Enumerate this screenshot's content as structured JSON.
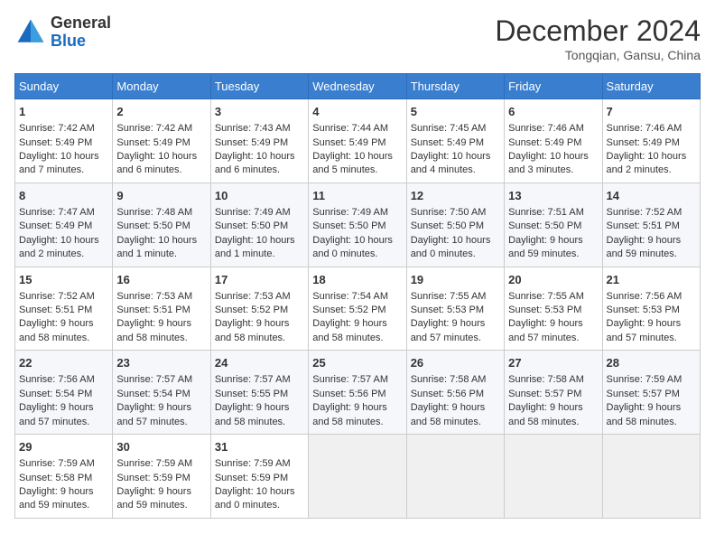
{
  "logo": {
    "general": "General",
    "blue": "Blue"
  },
  "title": "December 2024",
  "subtitle": "Tongqian, Gansu, China",
  "days": [
    "Sunday",
    "Monday",
    "Tuesday",
    "Wednesday",
    "Thursday",
    "Friday",
    "Saturday"
  ],
  "weeks": [
    [
      {
        "day": 1,
        "sunrise": "7:42 AM",
        "sunset": "5:49 PM",
        "daylight": "10 hours and 7 minutes."
      },
      {
        "day": 2,
        "sunrise": "7:42 AM",
        "sunset": "5:49 PM",
        "daylight": "10 hours and 6 minutes."
      },
      {
        "day": 3,
        "sunrise": "7:43 AM",
        "sunset": "5:49 PM",
        "daylight": "10 hours and 6 minutes."
      },
      {
        "day": 4,
        "sunrise": "7:44 AM",
        "sunset": "5:49 PM",
        "daylight": "10 hours and 5 minutes."
      },
      {
        "day": 5,
        "sunrise": "7:45 AM",
        "sunset": "5:49 PM",
        "daylight": "10 hours and 4 minutes."
      },
      {
        "day": 6,
        "sunrise": "7:46 AM",
        "sunset": "5:49 PM",
        "daylight": "10 hours and 3 minutes."
      },
      {
        "day": 7,
        "sunrise": "7:46 AM",
        "sunset": "5:49 PM",
        "daylight": "10 hours and 2 minutes."
      }
    ],
    [
      {
        "day": 8,
        "sunrise": "7:47 AM",
        "sunset": "5:49 PM",
        "daylight": "10 hours and 2 minutes."
      },
      {
        "day": 9,
        "sunrise": "7:48 AM",
        "sunset": "5:50 PM",
        "daylight": "10 hours and 1 minute."
      },
      {
        "day": 10,
        "sunrise": "7:49 AM",
        "sunset": "5:50 PM",
        "daylight": "10 hours and 1 minute."
      },
      {
        "day": 11,
        "sunrise": "7:49 AM",
        "sunset": "5:50 PM",
        "daylight": "10 hours and 0 minutes."
      },
      {
        "day": 12,
        "sunrise": "7:50 AM",
        "sunset": "5:50 PM",
        "daylight": "10 hours and 0 minutes."
      },
      {
        "day": 13,
        "sunrise": "7:51 AM",
        "sunset": "5:50 PM",
        "daylight": "9 hours and 59 minutes."
      },
      {
        "day": 14,
        "sunrise": "7:52 AM",
        "sunset": "5:51 PM",
        "daylight": "9 hours and 59 minutes."
      }
    ],
    [
      {
        "day": 15,
        "sunrise": "7:52 AM",
        "sunset": "5:51 PM",
        "daylight": "9 hours and 58 minutes."
      },
      {
        "day": 16,
        "sunrise": "7:53 AM",
        "sunset": "5:51 PM",
        "daylight": "9 hours and 58 minutes."
      },
      {
        "day": 17,
        "sunrise": "7:53 AM",
        "sunset": "5:52 PM",
        "daylight": "9 hours and 58 minutes."
      },
      {
        "day": 18,
        "sunrise": "7:54 AM",
        "sunset": "5:52 PM",
        "daylight": "9 hours and 58 minutes."
      },
      {
        "day": 19,
        "sunrise": "7:55 AM",
        "sunset": "5:53 PM",
        "daylight": "9 hours and 57 minutes."
      },
      {
        "day": 20,
        "sunrise": "7:55 AM",
        "sunset": "5:53 PM",
        "daylight": "9 hours and 57 minutes."
      },
      {
        "day": 21,
        "sunrise": "7:56 AM",
        "sunset": "5:53 PM",
        "daylight": "9 hours and 57 minutes."
      }
    ],
    [
      {
        "day": 22,
        "sunrise": "7:56 AM",
        "sunset": "5:54 PM",
        "daylight": "9 hours and 57 minutes."
      },
      {
        "day": 23,
        "sunrise": "7:57 AM",
        "sunset": "5:54 PM",
        "daylight": "9 hours and 57 minutes."
      },
      {
        "day": 24,
        "sunrise": "7:57 AM",
        "sunset": "5:55 PM",
        "daylight": "9 hours and 58 minutes."
      },
      {
        "day": 25,
        "sunrise": "7:57 AM",
        "sunset": "5:56 PM",
        "daylight": "9 hours and 58 minutes."
      },
      {
        "day": 26,
        "sunrise": "7:58 AM",
        "sunset": "5:56 PM",
        "daylight": "9 hours and 58 minutes."
      },
      {
        "day": 27,
        "sunrise": "7:58 AM",
        "sunset": "5:57 PM",
        "daylight": "9 hours and 58 minutes."
      },
      {
        "day": 28,
        "sunrise": "7:59 AM",
        "sunset": "5:57 PM",
        "daylight": "9 hours and 58 minutes."
      }
    ],
    [
      {
        "day": 29,
        "sunrise": "7:59 AM",
        "sunset": "5:58 PM",
        "daylight": "9 hours and 59 minutes."
      },
      {
        "day": 30,
        "sunrise": "7:59 AM",
        "sunset": "5:59 PM",
        "daylight": "9 hours and 59 minutes."
      },
      {
        "day": 31,
        "sunrise": "7:59 AM",
        "sunset": "5:59 PM",
        "daylight": "10 hours and 0 minutes."
      },
      null,
      null,
      null,
      null
    ]
  ]
}
